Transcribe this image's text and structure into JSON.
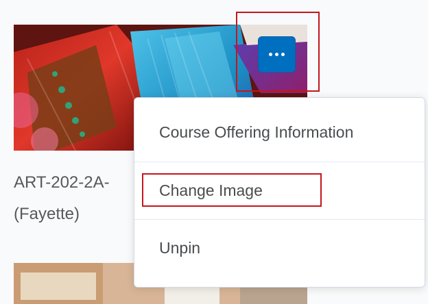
{
  "course_card": {
    "title_line1": "ART-202-2A-",
    "title_line2": "(Fayette)",
    "more_button_label": "Open course actions"
  },
  "menu": {
    "items": [
      {
        "label": "Course Offering Information"
      },
      {
        "label": "Change Image"
      },
      {
        "label": "Unpin"
      }
    ]
  },
  "colors": {
    "accent": "#006fbf",
    "highlight": "#c4161c",
    "text": "#565a5c"
  }
}
